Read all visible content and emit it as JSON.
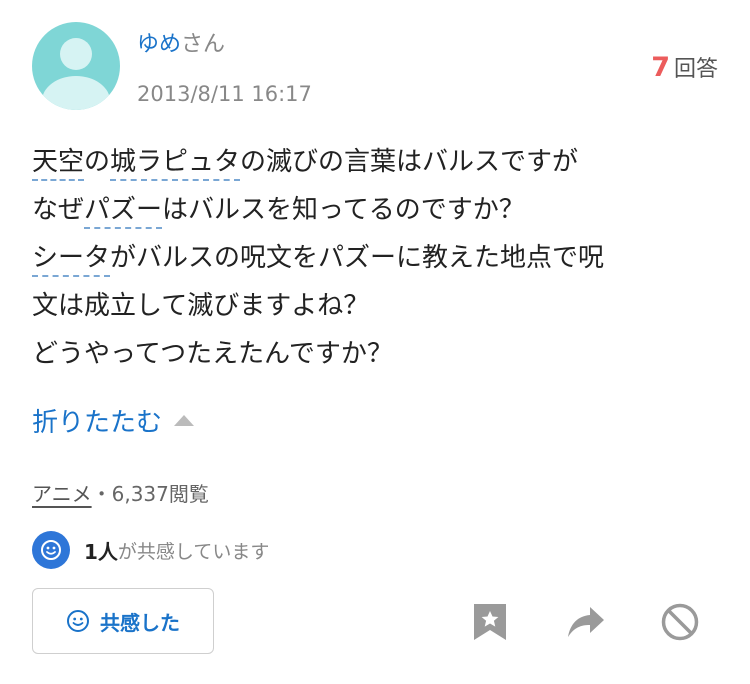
{
  "user": {
    "name": "ゆめ",
    "suffix": "さん",
    "posted_at": "2013/8/11 16:17"
  },
  "answers": {
    "count": "7",
    "label": "回答"
  },
  "question": {
    "lines": [
      {
        "a": "天空",
        "b": "の",
        "c": "城ラピュタ",
        "d": "の滅びの言葉はバルスですが"
      },
      {
        "a": "なぜ",
        "b": "パズー",
        "c": "はバルスを知ってるのですか？"
      },
      {
        "a": "シータ",
        "b": "がバルスの呪文をパズーに教えた地点で呪"
      },
      {
        "a": "文は成立して滅びますよね？"
      },
      {
        "a": "どうやってつたえたんですか？"
      }
    ]
  },
  "collapse_label": "折りたたむ",
  "meta": {
    "category": "アニメ",
    "separator": "・",
    "views": "6,337閲覧"
  },
  "empathy": {
    "count": "1人",
    "text": "が共感しています",
    "button_label": "共感した"
  },
  "colors": {
    "link": "#1a73c9",
    "accent_red": "#ec5c5c",
    "empathy_blue": "#2e76d8",
    "icon_gray": "#9a9a9a"
  },
  "icons": [
    "avatar-icon",
    "smile-icon",
    "bookmark-star-icon",
    "share-arrow-icon",
    "block-icon"
  ]
}
